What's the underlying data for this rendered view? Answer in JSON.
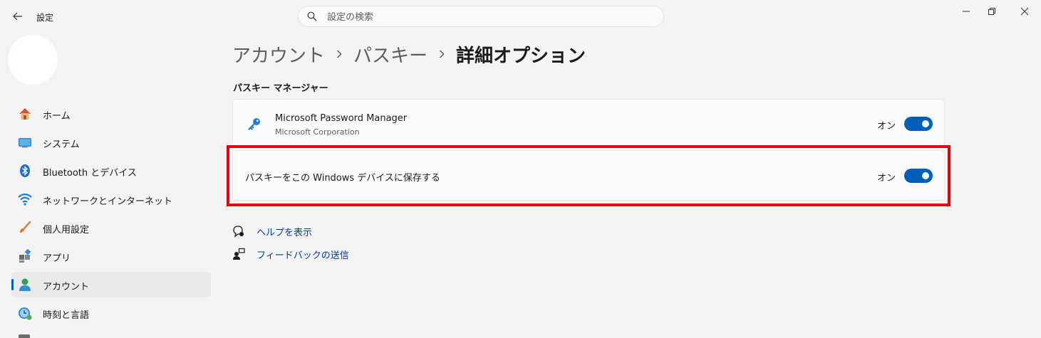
{
  "window": {
    "title": "設定",
    "controls": [
      "minimize-icon",
      "restore-icon",
      "close-icon"
    ]
  },
  "search": {
    "placeholder": "設定の検索",
    "value": ""
  },
  "sidebar": {
    "items": [
      {
        "label": "ホーム",
        "icon": "home-icon"
      },
      {
        "label": "システム",
        "icon": "system-icon"
      },
      {
        "label": "Bluetooth とデバイス",
        "icon": "bluetooth-icon"
      },
      {
        "label": "ネットワークとインターネット",
        "icon": "network-icon"
      },
      {
        "label": "個人用設定",
        "icon": "personalization-icon"
      },
      {
        "label": "アプリ",
        "icon": "apps-icon"
      },
      {
        "label": "アカウント",
        "icon": "accounts-icon",
        "selected": true
      },
      {
        "label": "時刻と言語",
        "icon": "time-language-icon"
      }
    ]
  },
  "breadcrumb": [
    "アカウント",
    "パスキー",
    "詳細オプション"
  ],
  "main": {
    "section_title": "パスキー マネージャー",
    "cards": [
      {
        "title": "Microsoft Password Manager",
        "subtitle": "Microsoft Corporation",
        "state": "オン",
        "toggle_on": true
      },
      {
        "title": "パスキーをこの Windows デバイスに保存する",
        "state": "オン",
        "toggle_on": true
      }
    ],
    "links": [
      {
        "label": "ヘルプを表示",
        "icon": "help-icon"
      },
      {
        "label": "フィードバックの送信",
        "icon": "feedback-icon"
      }
    ]
  },
  "colors": {
    "accent": "#005fb8",
    "highlight_border": "#e4000f",
    "link": "#003e92",
    "background": "#f3f3f3"
  }
}
